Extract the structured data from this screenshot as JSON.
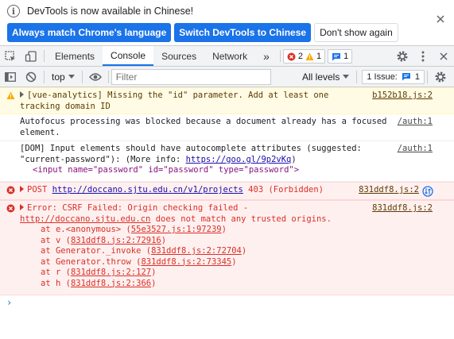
{
  "infobar": {
    "message": "DevTools is now available in Chinese!",
    "btn_match": "Always match Chrome's language",
    "btn_switch": "Switch DevTools to Chinese",
    "btn_dont_show": "Don't show again"
  },
  "tabs": [
    "Elements",
    "Console",
    "Sources",
    "Network"
  ],
  "more_tabs": "»",
  "counts": {
    "errors": "2",
    "warnings": "1",
    "messages": "1"
  },
  "toolbar": {
    "context": "top",
    "filter_placeholder": "Filter",
    "levels": "All levels",
    "issues_label": "1 Issue:",
    "issues_count": "1"
  },
  "messages": [
    {
      "level": "warning",
      "text": "[vue-analytics] Missing the \"id\" parameter. Add at least one tracking domain ID",
      "source": "b152b18.js:2"
    },
    {
      "level": "info",
      "text": "Autofocus processing was blocked because a document already has a focused element.",
      "source": "/auth:1"
    },
    {
      "level": "info",
      "text_pre": "[DOM] Input elements should have autocomplete attributes (suggested: \"current-password\"): (More info: ",
      "link": "https://goo.gl/9p2vKq",
      "text_post": ")",
      "element": "<input name=\"password\" id=\"password\" type=\"password\">",
      "source": "/auth:1"
    },
    {
      "level": "error",
      "method": "POST",
      "url": "http://doccano.sjtu.edu.cn/v1/projects",
      "status": "403 (Forbidden)",
      "source": "831ddf8.js:2"
    },
    {
      "level": "error",
      "text_pre": "Error: CSRF Failed: Origin checking failed - ",
      "link": "http://doccano.sjtu.edu.cn",
      "text_post": " does not match any trusted origins.",
      "source": "831ddf8.js:2",
      "stack": [
        {
          "fn": "at e.<anonymous> (",
          "loc": "55e3527.js:1:97239",
          "end": ")"
        },
        {
          "fn": "at v (",
          "loc": "831ddf8.js:2:72916",
          "end": ")"
        },
        {
          "fn": "at Generator._invoke (",
          "loc": "831ddf8.js:2:72704",
          "end": ")"
        },
        {
          "fn": "at Generator.throw (",
          "loc": "831ddf8.js:2:73345",
          "end": ")"
        },
        {
          "fn": "at r (",
          "loc": "831ddf8.js:2:127",
          "end": ")"
        },
        {
          "fn": "at h (",
          "loc": "831ddf8.js:2:366",
          "end": ")"
        }
      ]
    }
  ],
  "prompt": "›",
  "colors": {
    "accent": "#1a73e8",
    "error": "#d93025",
    "warning_bg": "#fffbe5",
    "error_bg": "#fff0f0"
  }
}
